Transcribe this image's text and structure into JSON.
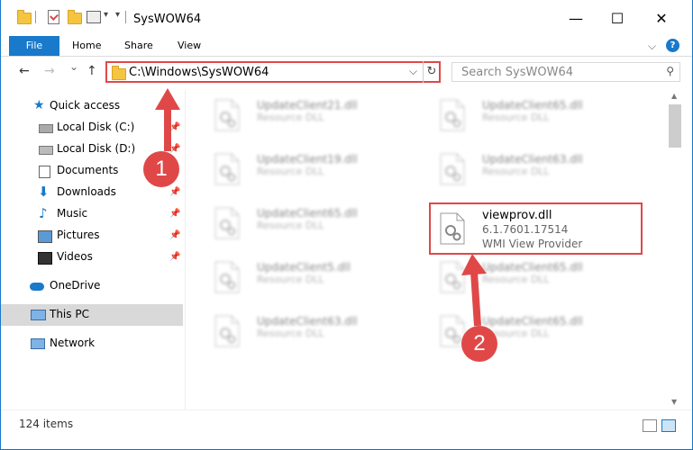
{
  "window": {
    "title": "SysWOW64",
    "controls": {
      "minimize": "—",
      "maximize": "☐",
      "close": "✕"
    }
  },
  "ribbon": {
    "tabs": [
      {
        "label": "File"
      },
      {
        "label": "Home"
      },
      {
        "label": "Share"
      },
      {
        "label": "View"
      }
    ],
    "expand_icon": "chevron-down-icon",
    "help_icon": "?"
  },
  "nav": {
    "back": "←",
    "forward": "→",
    "recent": "⌄",
    "up": "↑",
    "address": "C:\\Windows\\SysWOW64",
    "search_placeholder": "Search SysWOW64"
  },
  "sidebar": {
    "items": [
      {
        "label": "Quick access",
        "icon": "star-icon",
        "pinned": false
      },
      {
        "label": "Local Disk (C:)",
        "icon": "disk-icon",
        "pinned": true
      },
      {
        "label": "Local Disk (D:)",
        "icon": "disk-icon",
        "pinned": true
      },
      {
        "label": "Documents",
        "icon": "documents-icon",
        "pinned": false
      },
      {
        "label": "Downloads",
        "icon": "download-icon",
        "pinned": true
      },
      {
        "label": "Music",
        "icon": "music-icon",
        "pinned": true
      },
      {
        "label": "Pictures",
        "icon": "pictures-icon",
        "pinned": true
      },
      {
        "label": "Videos",
        "icon": "videos-icon",
        "pinned": true
      },
      {
        "label": "OneDrive",
        "icon": "cloud-icon",
        "pinned": false
      },
      {
        "label": "This PC",
        "icon": "pc-icon",
        "pinned": false,
        "selected": true
      },
      {
        "label": "Network",
        "icon": "network-icon",
        "pinned": false
      }
    ]
  },
  "files": [
    {
      "name": "UpdateClient21.dll",
      "desc": "Resource DLL"
    },
    {
      "name": "UpdateClient65.dll",
      "desc": "Resource DLL"
    },
    {
      "name": "UpdateClient19.dll",
      "desc": "Resource DLL"
    },
    {
      "name": "UpdateClient63.dll",
      "desc": "Resource DLL"
    },
    {
      "name": "UpdateClient65.dll",
      "desc": "Resource DLL"
    },
    {
      "name": "viewprov.dll",
      "version": "6.1.7601.17514",
      "desc": "WMI View Provider"
    },
    {
      "name": "UpdateClient5.dll",
      "desc": "Resource DLL"
    },
    {
      "name": "UpdateClient65.dll",
      "desc": "Resource DLL"
    },
    {
      "name": "UpdateClient63.dll",
      "desc": "Resource DLL"
    },
    {
      "name": "UpdateClient65.dll",
      "desc": "Resource DLL"
    }
  ],
  "status": {
    "item_count": "124 items"
  },
  "annotations": {
    "step1": "1",
    "step2": "2"
  },
  "colors": {
    "accent": "#1979ca",
    "highlight": "#e04848",
    "folder": "#f5c542"
  }
}
